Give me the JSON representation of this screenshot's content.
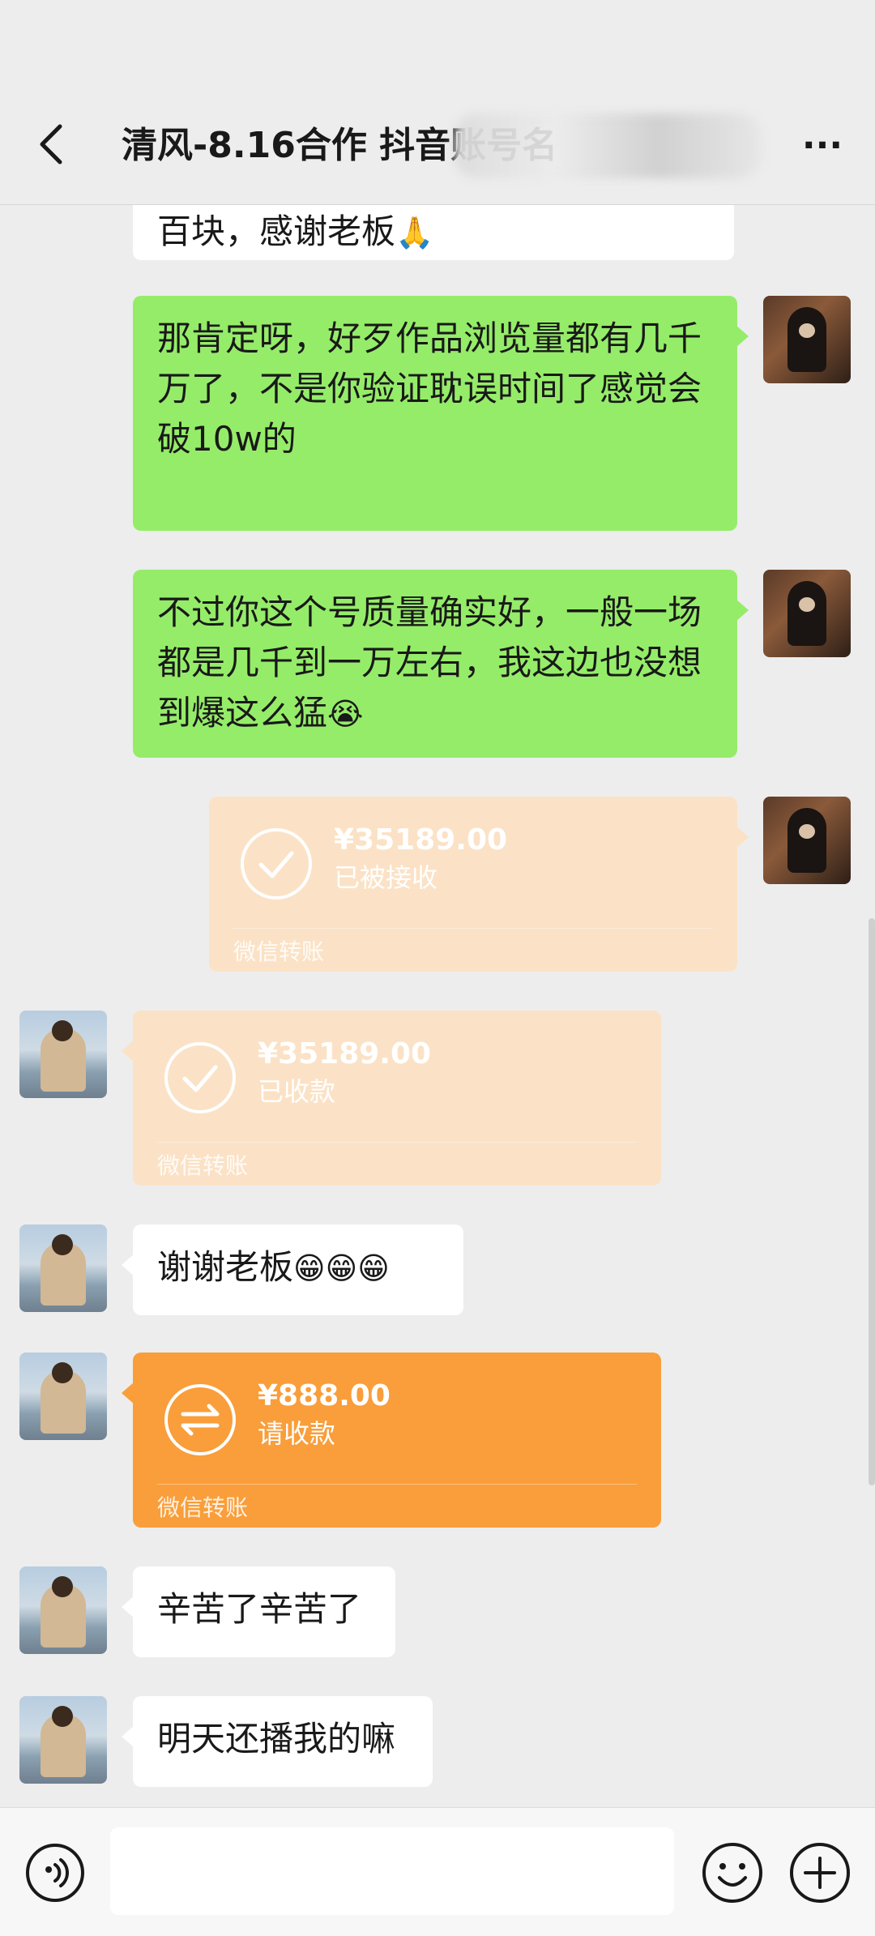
{
  "header": {
    "title": "清风-8.16合作 抖音账号名",
    "back_icon": "chevron-left-icon",
    "more_icon": "more-dots-icon",
    "more_label": "···"
  },
  "messages": {
    "m0": {
      "sender": "other",
      "text": "百块，感谢老板",
      "emoji": "🙏"
    },
    "m1": {
      "sender": "me",
      "text": "那肯定呀，好歹作品浏览量都有几千万了，不是你验证耽误时间了感觉会破10w的"
    },
    "m2": {
      "sender": "me",
      "text": "不过你这个号质量确实好，一般一场都是几千到一万左右，我这边也没想到爆这么猛",
      "emoji": "😭"
    },
    "m3": {
      "sender": "me",
      "type": "transfer",
      "amount": "¥35189.00",
      "status": "已被接收",
      "label": "微信转账",
      "icon": "check-circle-icon"
    },
    "m4": {
      "sender": "other",
      "type": "transfer",
      "amount": "¥35189.00",
      "status": "已收款",
      "label": "微信转账",
      "icon": "check-circle-icon"
    },
    "m5": {
      "sender": "other",
      "text": "谢谢老板",
      "emoji": "😁😁😁"
    },
    "m6": {
      "sender": "other",
      "type": "transfer",
      "amount": "¥888.00",
      "status": "请收款",
      "label": "微信转账",
      "icon": "transfer-arrows-icon"
    },
    "m7": {
      "sender": "other",
      "text": "辛苦了辛苦了"
    },
    "m8": {
      "sender": "other",
      "text": "明天还播我的嘛"
    }
  },
  "input_bar": {
    "voice_icon": "voice-icon",
    "input_value": "",
    "emoji_icon": "emoji-smile-icon",
    "plus_icon": "plus-circle-icon"
  },
  "colors": {
    "background": "#ededed",
    "sent_bubble": "#95ec69",
    "received_bubble": "#ffffff",
    "transfer_done": "#fbe2c6",
    "transfer_pending": "#f99e3a"
  }
}
